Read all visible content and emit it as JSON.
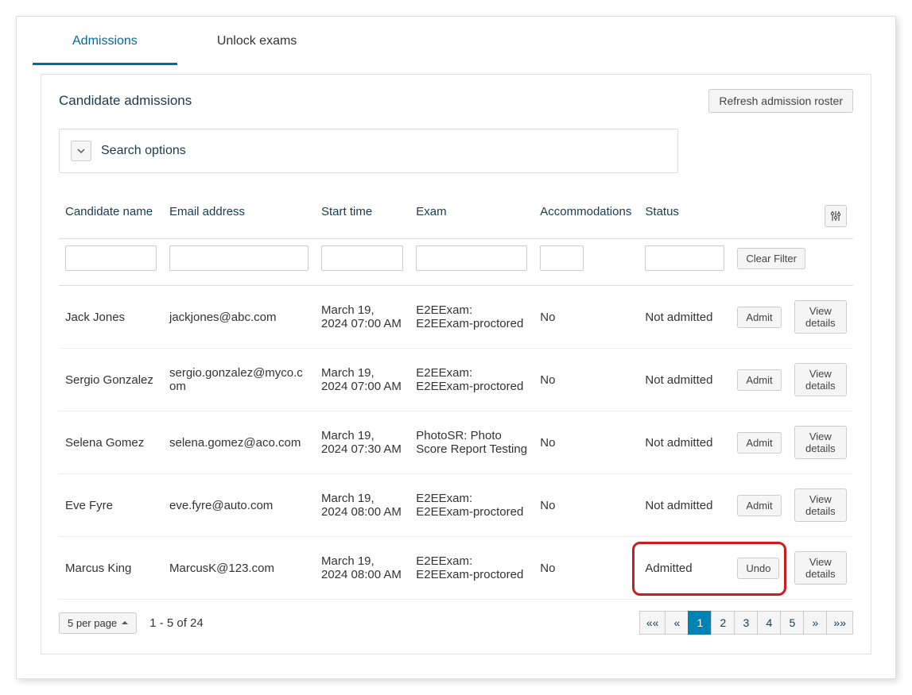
{
  "tabs": {
    "admissions": "Admissions",
    "unlock_exams": "Unlock exams"
  },
  "panel": {
    "title": "Candidate admissions",
    "refresh_label": "Refresh admission roster",
    "search_options_label": "Search options"
  },
  "columns": {
    "name": "Candidate name",
    "email": "Email address",
    "start": "Start time",
    "exam": "Exam",
    "accom": "Accommodations",
    "status": "Status"
  },
  "clear_filter_label": "Clear Filter",
  "buttons": {
    "admit": "Admit",
    "undo": "Undo",
    "view_details": "View details"
  },
  "rows": [
    {
      "name": "Jack Jones",
      "email": "jackjones@abc.com",
      "start": "March 19, 2024 07:00 AM",
      "exam": "E2EExam: E2EExam-proctored",
      "accom": "No",
      "status": "Not admitted",
      "action": "Admit"
    },
    {
      "name": "Sergio Gonzalez",
      "email": "sergio.gonzalez@myco.com",
      "start": "March 19, 2024 07:00 AM",
      "exam": "E2EExam: E2EExam-proctored",
      "accom": "No",
      "status": "Not admitted",
      "action": "Admit"
    },
    {
      "name": "Selena Gomez",
      "email": "selena.gomez@aco.com",
      "start": "March 19, 2024 07:30 AM",
      "exam": "PhotoSR: Photo Score Report Testing",
      "accom": "No",
      "status": "Not admitted",
      "action": "Admit"
    },
    {
      "name": "Eve Fyre",
      "email": "eve.fyre@auto.com",
      "start": "March 19, 2024 08:00 AM",
      "exam": "E2EExam: E2EExam-proctored",
      "accom": "No",
      "status": "Not admitted",
      "action": "Admit"
    },
    {
      "name": "Marcus King",
      "email": "MarcusK@123.com",
      "start": "March 19, 2024 08:00 AM",
      "exam": "E2EExam: E2EExam-proctored",
      "accom": "No",
      "status": "Admitted",
      "action": "Undo",
      "highlight": true
    }
  ],
  "pager": {
    "per_page_label": "5 per page",
    "range_label": "1 - 5 of 24",
    "pages": [
      "1",
      "2",
      "3",
      "4",
      "5"
    ],
    "first": "««",
    "prev": "«",
    "next": "»",
    "last": "»»",
    "active": "1"
  }
}
